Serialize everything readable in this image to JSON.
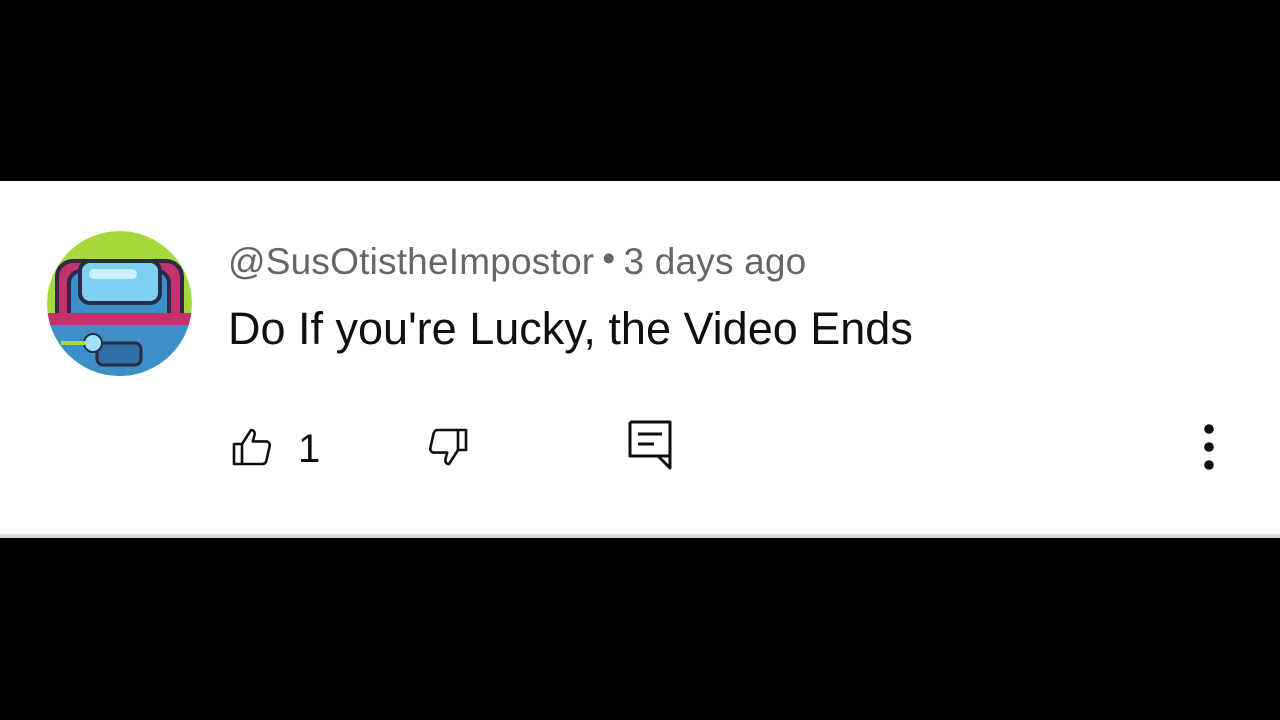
{
  "comment": {
    "author": "@SusOtistheImpostor",
    "separator": "•",
    "time": "3 days ago",
    "text": "Do If you're Lucky, the Video Ends",
    "like_count": "1"
  },
  "icons": {
    "like": "thumb-up-icon",
    "dislike": "thumb-down-icon",
    "reply": "comment-reply-icon",
    "more": "more-vertical-icon"
  },
  "colors": {
    "background": "#000000",
    "card": "#ffffff",
    "meta_text": "#666666",
    "body_text": "#0f0f0f",
    "avatar_ring": "#a6d93c",
    "avatar_band": "#c2326b",
    "avatar_window": "#7fcff0",
    "avatar_body": "#3d8fc7"
  }
}
